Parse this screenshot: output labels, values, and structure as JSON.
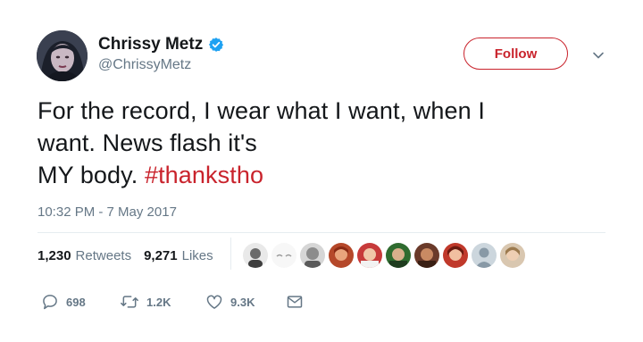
{
  "user": {
    "display_name": "Chrissy Metz",
    "handle": "@ChrissyMetz",
    "verified_icon": "verified-badge-icon"
  },
  "follow_label": "Follow",
  "tweet": {
    "text_lines": [
      "For the record, I wear what I want, when I",
      "want. News flash it's"
    ],
    "text_last_prefix": "MY body. ",
    "hashtag": "#thankstho",
    "timestamp": "10:32 PM - 7 May 2017"
  },
  "stats": {
    "retweets_count": "1,230",
    "retweets_label": "Retweets",
    "likes_count": "9,271",
    "likes_label": "Likes"
  },
  "actions": {
    "reply_count": "698",
    "retweet_count": "1.2K",
    "like_count": "9.3K"
  },
  "colors": {
    "accent": "#c9232c",
    "secondary_text": "#657786",
    "verified": "#1da1f2",
    "divider": "#e6ecf0"
  },
  "icons": [
    "reply-icon",
    "retweet-icon",
    "heart-icon",
    "envelope-icon",
    "chevron-down-icon"
  ]
}
